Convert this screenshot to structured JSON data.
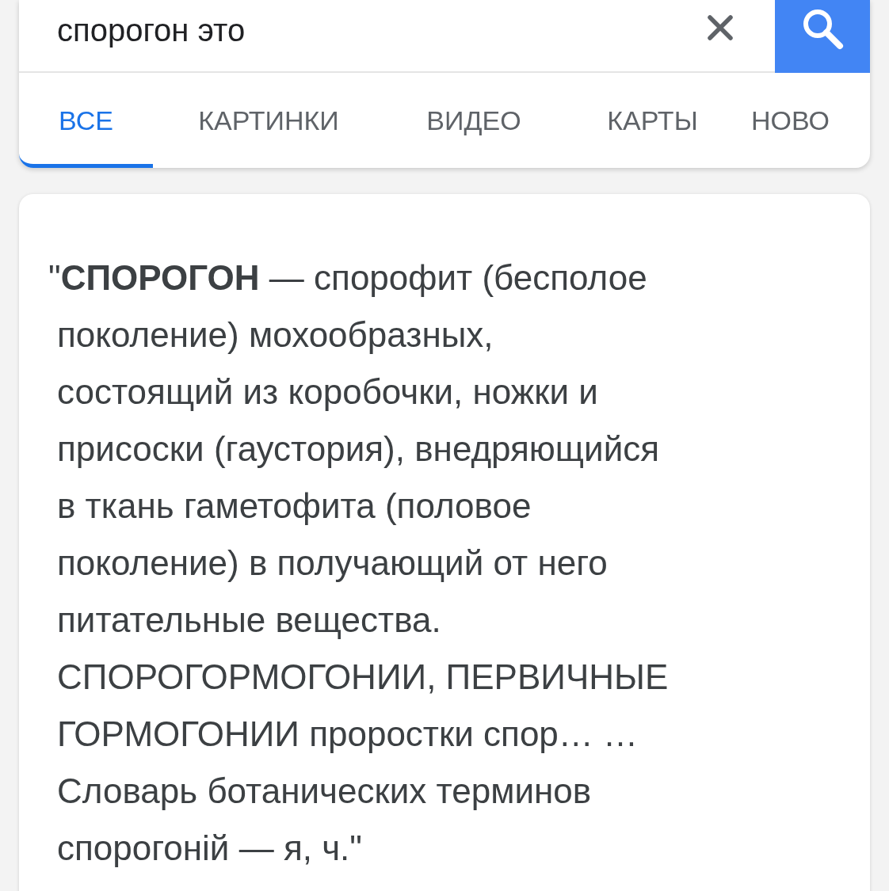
{
  "search": {
    "query": "спорогон это"
  },
  "tabs": [
    {
      "label": "ВСЕ",
      "selected": true
    },
    {
      "label": "КАРТИНКИ",
      "selected": false
    },
    {
      "label": "ВИДЕО",
      "selected": false
    },
    {
      "label": "КАРТЫ",
      "selected": false
    },
    {
      "label": "НОВО",
      "selected": false
    }
  ],
  "result": {
    "lines": [
      "\"**СПОРОГОН** — спорофит (бесполое",
      "поколение) мохообразных,",
      "состоящий из коробочки, ножки и",
      "присоски (гаустория), внедряющийся",
      "в ткань гаметофита (половое",
      "поколение) в получающий от него",
      "питательные вещества.",
      "СПОРОГОРМОГОНИИ, ПЕРВИЧНЫЕ",
      "ГОРМОГОНИИ проростки спор… …",
      "Словарь ботанических терминов",
      "спорогоній — я, ч.\""
    ]
  }
}
